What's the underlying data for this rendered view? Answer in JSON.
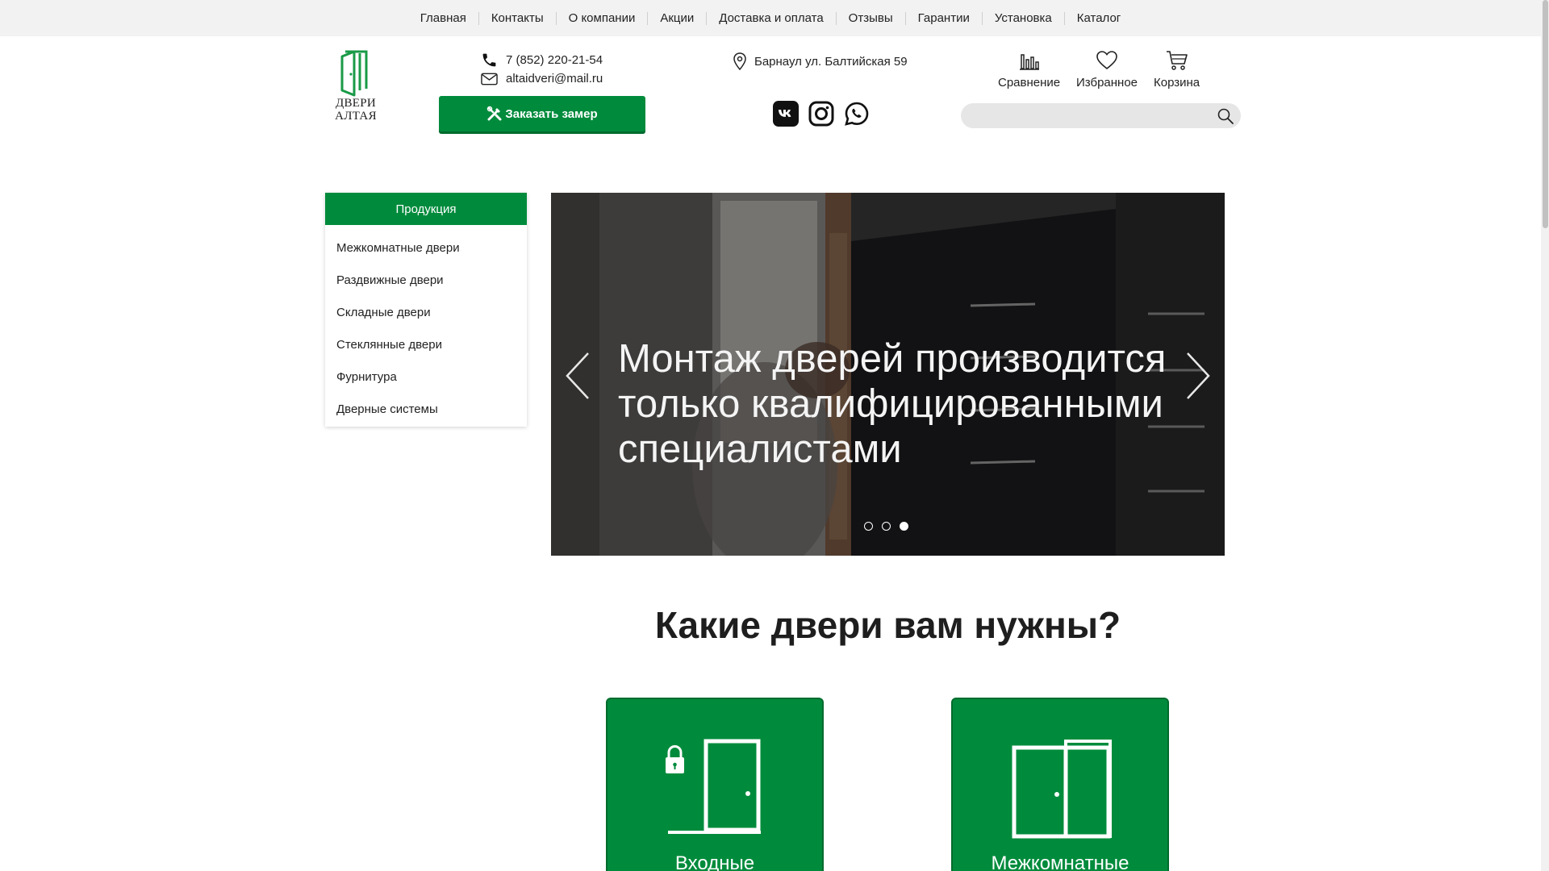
{
  "topnav": {
    "items": [
      "Главная",
      "Контакты",
      "О компании",
      "Акции",
      "Доставка и оплата",
      "Отзывы",
      "Гарантии",
      "Установка",
      "Каталог"
    ]
  },
  "logo": {
    "line1": "ДВЕРИ",
    "line2": "АЛТАЯ"
  },
  "contact": {
    "phone": "7 (852) 220-21-54",
    "email": "altaidveri@mail.ru"
  },
  "order_button": {
    "label": "Заказать замер"
  },
  "address": "Барнаул ул. Балтийская 59",
  "header_icons": {
    "compare": "Сравнение",
    "favorites": "Избранное",
    "cart": "Корзина"
  },
  "search": {
    "placeholder": ""
  },
  "sidebar": {
    "title": "Продукция",
    "items": [
      "Межкомнатные двери",
      "Раздвижные двери",
      "Складные двери",
      "Стеклянные двери",
      "Фурнитура",
      "Дверные системы"
    ]
  },
  "slider": {
    "text": "Монтаж дверей производится только квалифицированными специалистами",
    "slide_count": 3,
    "active_slide": 3
  },
  "section": {
    "heading_pre": "Какие ",
    "heading_bold": "двери",
    "heading_post": " вам нужны?"
  },
  "cards": [
    {
      "title": "Входные",
      "icon": "entrance-door-lock-icon"
    },
    {
      "title": "Межкомнатные",
      "icon": "interior-double-door-icon"
    }
  ],
  "colors": {
    "brand_green": "#008b3c",
    "nav_bg": "#f2f2f2",
    "search_bg": "#e6e6e6"
  }
}
